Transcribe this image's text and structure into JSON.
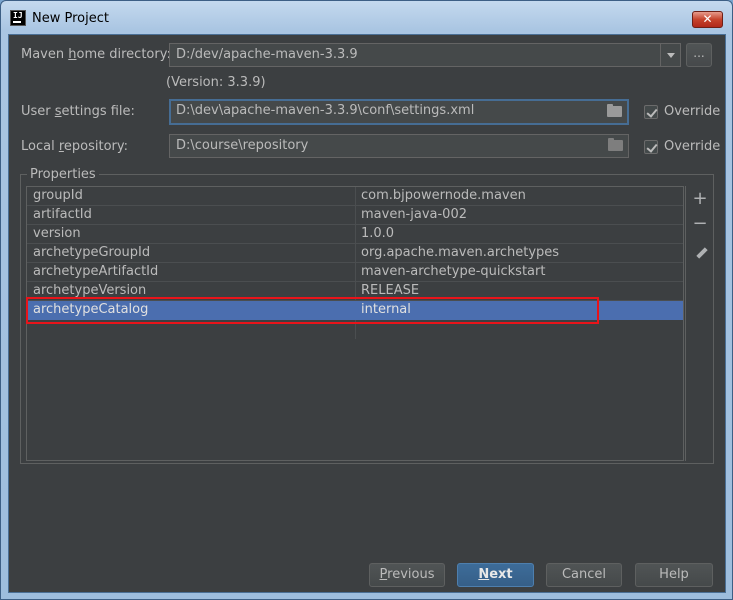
{
  "window": {
    "title": "New Project",
    "app_icon_text": "IJ",
    "close_glyph": "✕"
  },
  "maven": {
    "home_label_pre": "Maven ",
    "home_label_mnemonic": "h",
    "home_label_post": "ome directory:",
    "home_value": "D:/dev/apache-maven-3.3.9",
    "browse_label": "...",
    "version_text": "(Version: 3.3.9)",
    "settings_label_pre": "User ",
    "settings_label_mnemonic": "s",
    "settings_label_post": "ettings file:",
    "settings_value": "D:\\dev\\apache-maven-3.3.9\\conf\\settings.xml",
    "settings_override": true,
    "override_label": "Override",
    "repo_label_pre": "Local ",
    "repo_label_mnemonic": "r",
    "repo_label_post": "epository:",
    "repo_value": "D:\\course\\repository",
    "repo_override": true
  },
  "properties": {
    "title": "Properties",
    "rows": [
      {
        "key": "groupId",
        "value": "com.bjpowernode.maven"
      },
      {
        "key": "artifactId",
        "value": "maven-java-002"
      },
      {
        "key": "version",
        "value": "1.0.0"
      },
      {
        "key": "archetypeGroupId",
        "value": "org.apache.maven.archetypes"
      },
      {
        "key": "archetypeArtifactId",
        "value": "maven-archetype-quickstart"
      },
      {
        "key": "archetypeVersion",
        "value": "RELEASE"
      },
      {
        "key": "archetypeCatalog",
        "value": "internal"
      }
    ],
    "selected_index": 6,
    "add_glyph": "+",
    "remove_glyph": "−"
  },
  "footer": {
    "previous_mnemonic": "P",
    "previous_rest": "revious",
    "next_mnemonic": "N",
    "next_rest": "ext",
    "cancel": "Cancel",
    "help": "Help"
  },
  "colors": {
    "panel_bg": "#3c3f41",
    "selection": "#4b6eaf",
    "highlight_box": "#e8141a",
    "primary_button": "#365f88"
  }
}
